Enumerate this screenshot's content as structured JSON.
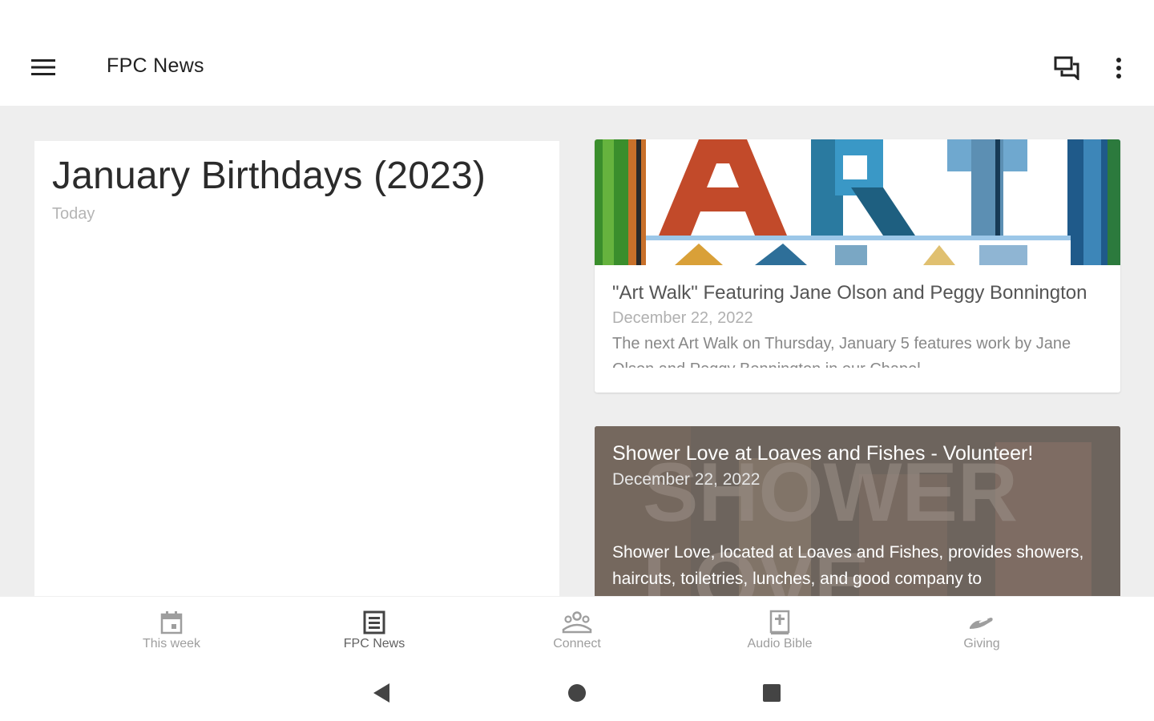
{
  "app_bar": {
    "title": "FPC News",
    "icons": {
      "menu": "hamburger-menu-icon",
      "chat": "chat-bubbles-icon",
      "more": "more-vert-icon"
    }
  },
  "feature": {
    "title": "January Birthdays (2023)",
    "date": "Today"
  },
  "cards": [
    {
      "banner_text": "ART WALK",
      "title": "\"Art Walk\" Featuring Jane Olson and Peggy Bonnington",
      "date": "December 22, 2022",
      "excerpt": "The next Art Walk on Thursday, January 5 features work by Jane Olson and Peggy Bonnington in our Chapel"
    },
    {
      "background_text": "SHOWER LOVE",
      "title": "Shower Love at Loaves and Fishes - Volunteer!",
      "date": "December 22, 2022",
      "excerpt": "Shower Love, located at Loaves and Fishes, provides showers, haircuts, toiletries, lunches, and good company to"
    }
  ],
  "bottom_nav": [
    {
      "label": "This week",
      "icon": "calendar-icon",
      "active": false
    },
    {
      "label": "FPC News",
      "icon": "news-icon",
      "active": true
    },
    {
      "label": "Connect",
      "icon": "people-icon",
      "active": false
    },
    {
      "label": "Audio Bible",
      "icon": "bible-icon",
      "active": false
    },
    {
      "label": "Giving",
      "icon": "giving-hand-icon",
      "active": false
    }
  ],
  "system_nav": {
    "back": "back-triangle-icon",
    "home": "home-circle-icon",
    "recents": "recents-square-icon"
  },
  "colors": {
    "content_bg": "#eeeeee",
    "text_primary": "#212121",
    "nav_inactive": "#9e9e9e"
  }
}
